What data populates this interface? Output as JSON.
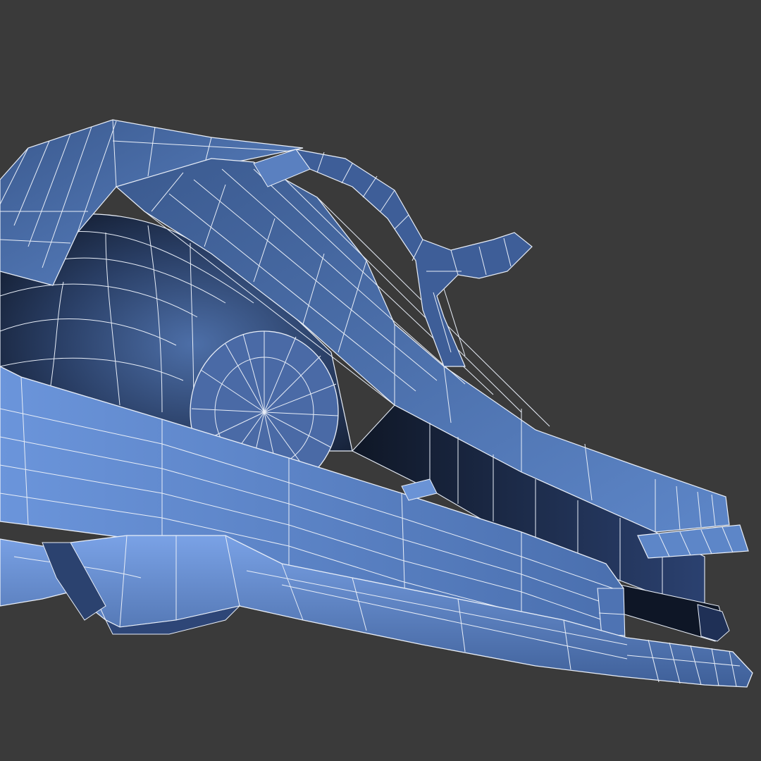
{
  "viewport": {
    "background": "#3a3a3a",
    "mesh_fill_dark": "#1a2740",
    "mesh_fill_mid": "#3f5f95",
    "mesh_fill_light": "#6d95d8",
    "wire_color": "#e8eef8"
  }
}
